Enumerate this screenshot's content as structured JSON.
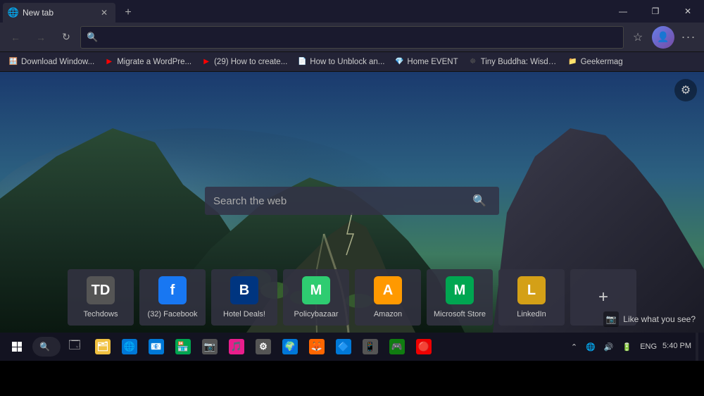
{
  "titlebar": {
    "tab_title": "New tab",
    "new_tab_label": "+",
    "win_minimize": "—",
    "win_restore": "❐",
    "win_close": "✕"
  },
  "navbar": {
    "back_disabled": true,
    "forward_disabled": true,
    "address_placeholder": "",
    "favorites_icon": "★",
    "more_icon": "···"
  },
  "bookmarks": [
    {
      "label": "Download Window...",
      "color": "#0078d7",
      "icon": "🪟"
    },
    {
      "label": "Migrate a WordPre...",
      "color": "#ff0000",
      "icon": "▶"
    },
    {
      "label": "(29) How to create...",
      "color": "#ff0000",
      "icon": "▶"
    },
    {
      "label": "How to Unblock an...",
      "color": "#555",
      "icon": "📄"
    },
    {
      "label": "Home EVENT",
      "color": "#e91e8c",
      "icon": "💎"
    },
    {
      "label": "Tiny Buddha: Wisdo...",
      "color": "#555",
      "icon": "☸"
    },
    {
      "label": "Geekermag",
      "color": "#f0c040",
      "icon": "📁"
    }
  ],
  "newtab": {
    "search_placeholder": "Search the web",
    "search_icon": "🔍",
    "settings_icon": "⚙"
  },
  "quick_links": [
    {
      "label": "Techdows",
      "icon_text": "TD",
      "icon_color": "#555555",
      "text_color": "#fff"
    },
    {
      "label": "(32) Facebook",
      "icon_text": "f",
      "icon_color": "#1877f2",
      "text_color": "#fff"
    },
    {
      "label": "Hotel Deals!",
      "icon_text": "B",
      "icon_color": "#003580",
      "text_color": "#fff"
    },
    {
      "label": "Policybazaar",
      "icon_text": "M",
      "icon_color": "#2ecc71",
      "text_color": "#fff"
    },
    {
      "label": "Amazon",
      "icon_text": "A",
      "icon_color": "#ff9900",
      "text_color": "#fff"
    },
    {
      "label": "Microsoft Store",
      "icon_text": "M",
      "icon_color": "#00a651",
      "text_color": "#fff"
    },
    {
      "label": "LinkedIn",
      "icon_text": "L",
      "icon_color": "#d4a017",
      "text_color": "#fff"
    },
    {
      "label": "Add",
      "icon_text": "+",
      "icon_color": "transparent",
      "text_color": "#ccc"
    }
  ],
  "like_what_you_see": "Like what you see?",
  "taskbar": {
    "clock_time": "5:40 PM",
    "clock_date": "",
    "lang": "ENG",
    "apps": [
      {
        "icon": "🗂",
        "color": "#f0c040",
        "label": "File Explorer"
      },
      {
        "icon": "🌐",
        "color": "#0078d7",
        "label": "Edge"
      },
      {
        "icon": "📧",
        "color": "#0078d7",
        "label": "Mail"
      },
      {
        "icon": "🏪",
        "color": "#00a651",
        "label": "Store"
      },
      {
        "icon": "📷",
        "color": "#555",
        "label": "Camera"
      },
      {
        "icon": "🎵",
        "color": "#e91e8c",
        "label": "Music"
      },
      {
        "icon": "⚙",
        "color": "#555",
        "label": "Settings"
      },
      {
        "icon": "🌍",
        "color": "#0078d7",
        "label": "Chrome"
      },
      {
        "icon": "🦊",
        "color": "#ff6600",
        "label": "Firefox"
      },
      {
        "icon": "🔷",
        "color": "#0078d7",
        "label": "Edge2"
      },
      {
        "icon": "📱",
        "color": "#555",
        "label": "Phone"
      },
      {
        "icon": "🎮",
        "color": "#107c10",
        "label": "Xbox"
      },
      {
        "icon": "🔴",
        "color": "#e00",
        "label": "App"
      }
    ]
  }
}
